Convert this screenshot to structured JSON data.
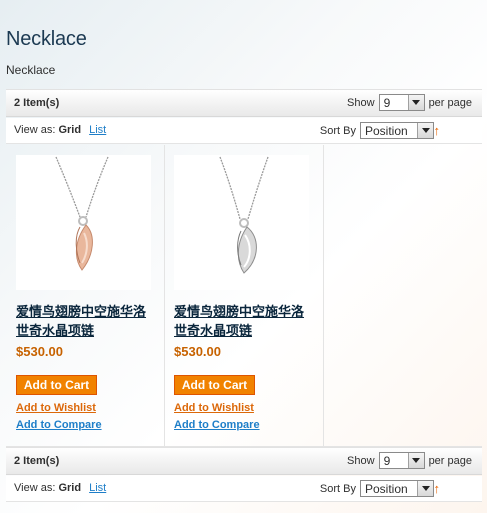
{
  "page": {
    "title": "Necklace",
    "description": "Necklace"
  },
  "toolbar_top": {
    "amount": "2 Item(s)",
    "show_label": "Show",
    "limit_value": "9",
    "per_page_label": "per page",
    "view_as_label": "View as:",
    "view_grid": "Grid",
    "view_list": "List",
    "sort_by_label": "Sort By",
    "sort_value": "Position",
    "sort_direction_icon": "↑"
  },
  "toolbar_bottom": {
    "amount": "2 Item(s)",
    "show_label": "Show",
    "limit_value": "9",
    "per_page_label": "per page",
    "view_as_label": "View as:",
    "view_grid": "Grid",
    "view_list": "List",
    "sort_by_label": "Sort By",
    "sort_value": "Position",
    "sort_direction_icon": "↑"
  },
  "products": [
    {
      "name": "爱情鸟翅膀中空施华洛世奇水晶项链",
      "price": "$530.00",
      "add_to_cart": "Add to Cart",
      "add_to_wishlist": "Add to Wishlist",
      "add_to_compare": "Add to Compare",
      "image_icon": "necklace-rose-gold-wing"
    },
    {
      "name": "爱情鸟翅膀中空施华洛世奇水晶项链",
      "price": "$530.00",
      "add_to_cart": "Add to Cart",
      "add_to_wishlist": "Add to Wishlist",
      "add_to_compare": "Add to Compare",
      "image_icon": "necklace-silver-wing"
    }
  ],
  "colors": {
    "accent": "#f18200",
    "price": "#c76200",
    "link": "#1e7ec8",
    "wishlist": "#dc6809"
  }
}
